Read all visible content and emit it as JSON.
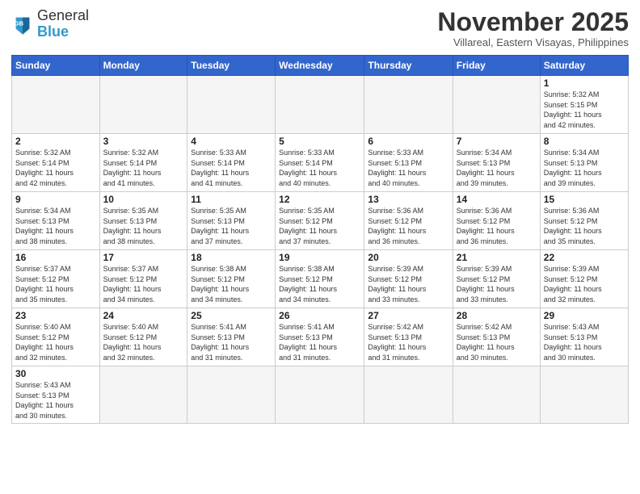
{
  "header": {
    "logo_line1": "General",
    "logo_line2": "Blue",
    "month": "November 2025",
    "location": "Villareal, Eastern Visayas, Philippines"
  },
  "weekdays": [
    "Sunday",
    "Monday",
    "Tuesday",
    "Wednesday",
    "Thursday",
    "Friday",
    "Saturday"
  ],
  "days": [
    {
      "date": "",
      "info": ""
    },
    {
      "date": "",
      "info": ""
    },
    {
      "date": "",
      "info": ""
    },
    {
      "date": "",
      "info": ""
    },
    {
      "date": "",
      "info": ""
    },
    {
      "date": "",
      "info": ""
    },
    {
      "date": "1",
      "info": "Sunrise: 5:32 AM\nSunset: 5:15 PM\nDaylight: 11 hours\nand 42 minutes."
    },
    {
      "date": "2",
      "info": "Sunrise: 5:32 AM\nSunset: 5:14 PM\nDaylight: 11 hours\nand 42 minutes."
    },
    {
      "date": "3",
      "info": "Sunrise: 5:32 AM\nSunset: 5:14 PM\nDaylight: 11 hours\nand 41 minutes."
    },
    {
      "date": "4",
      "info": "Sunrise: 5:33 AM\nSunset: 5:14 PM\nDaylight: 11 hours\nand 41 minutes."
    },
    {
      "date": "5",
      "info": "Sunrise: 5:33 AM\nSunset: 5:14 PM\nDaylight: 11 hours\nand 40 minutes."
    },
    {
      "date": "6",
      "info": "Sunrise: 5:33 AM\nSunset: 5:13 PM\nDaylight: 11 hours\nand 40 minutes."
    },
    {
      "date": "7",
      "info": "Sunrise: 5:34 AM\nSunset: 5:13 PM\nDaylight: 11 hours\nand 39 minutes."
    },
    {
      "date": "8",
      "info": "Sunrise: 5:34 AM\nSunset: 5:13 PM\nDaylight: 11 hours\nand 39 minutes."
    },
    {
      "date": "9",
      "info": "Sunrise: 5:34 AM\nSunset: 5:13 PM\nDaylight: 11 hours\nand 38 minutes."
    },
    {
      "date": "10",
      "info": "Sunrise: 5:35 AM\nSunset: 5:13 PM\nDaylight: 11 hours\nand 38 minutes."
    },
    {
      "date": "11",
      "info": "Sunrise: 5:35 AM\nSunset: 5:13 PM\nDaylight: 11 hours\nand 37 minutes."
    },
    {
      "date": "12",
      "info": "Sunrise: 5:35 AM\nSunset: 5:12 PM\nDaylight: 11 hours\nand 37 minutes."
    },
    {
      "date": "13",
      "info": "Sunrise: 5:36 AM\nSunset: 5:12 PM\nDaylight: 11 hours\nand 36 minutes."
    },
    {
      "date": "14",
      "info": "Sunrise: 5:36 AM\nSunset: 5:12 PM\nDaylight: 11 hours\nand 36 minutes."
    },
    {
      "date": "15",
      "info": "Sunrise: 5:36 AM\nSunset: 5:12 PM\nDaylight: 11 hours\nand 35 minutes."
    },
    {
      "date": "16",
      "info": "Sunrise: 5:37 AM\nSunset: 5:12 PM\nDaylight: 11 hours\nand 35 minutes."
    },
    {
      "date": "17",
      "info": "Sunrise: 5:37 AM\nSunset: 5:12 PM\nDaylight: 11 hours\nand 34 minutes."
    },
    {
      "date": "18",
      "info": "Sunrise: 5:38 AM\nSunset: 5:12 PM\nDaylight: 11 hours\nand 34 minutes."
    },
    {
      "date": "19",
      "info": "Sunrise: 5:38 AM\nSunset: 5:12 PM\nDaylight: 11 hours\nand 34 minutes."
    },
    {
      "date": "20",
      "info": "Sunrise: 5:39 AM\nSunset: 5:12 PM\nDaylight: 11 hours\nand 33 minutes."
    },
    {
      "date": "21",
      "info": "Sunrise: 5:39 AM\nSunset: 5:12 PM\nDaylight: 11 hours\nand 33 minutes."
    },
    {
      "date": "22",
      "info": "Sunrise: 5:39 AM\nSunset: 5:12 PM\nDaylight: 11 hours\nand 32 minutes."
    },
    {
      "date": "23",
      "info": "Sunrise: 5:40 AM\nSunset: 5:12 PM\nDaylight: 11 hours\nand 32 minutes."
    },
    {
      "date": "24",
      "info": "Sunrise: 5:40 AM\nSunset: 5:12 PM\nDaylight: 11 hours\nand 32 minutes."
    },
    {
      "date": "25",
      "info": "Sunrise: 5:41 AM\nSunset: 5:13 PM\nDaylight: 11 hours\nand 31 minutes."
    },
    {
      "date": "26",
      "info": "Sunrise: 5:41 AM\nSunset: 5:13 PM\nDaylight: 11 hours\nand 31 minutes."
    },
    {
      "date": "27",
      "info": "Sunrise: 5:42 AM\nSunset: 5:13 PM\nDaylight: 11 hours\nand 31 minutes."
    },
    {
      "date": "28",
      "info": "Sunrise: 5:42 AM\nSunset: 5:13 PM\nDaylight: 11 hours\nand 30 minutes."
    },
    {
      "date": "29",
      "info": "Sunrise: 5:43 AM\nSunset: 5:13 PM\nDaylight: 11 hours\nand 30 minutes."
    },
    {
      "date": "30",
      "info": "Sunrise: 5:43 AM\nSunset: 5:13 PM\nDaylight: 11 hours\nand 30 minutes."
    },
    {
      "date": "",
      "info": ""
    },
    {
      "date": "",
      "info": ""
    },
    {
      "date": "",
      "info": ""
    },
    {
      "date": "",
      "info": ""
    },
    {
      "date": "",
      "info": ""
    },
    {
      "date": "",
      "info": ""
    }
  ]
}
